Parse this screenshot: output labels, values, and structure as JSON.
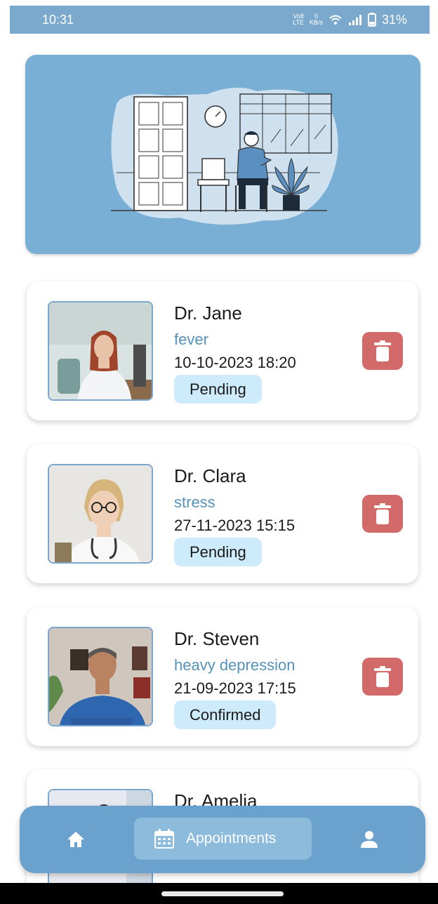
{
  "status_bar": {
    "time": "10:31",
    "net_label_top": "Vo8",
    "net_label_bottom": "LTE",
    "speed_value": "0",
    "speed_unit": "KB/s",
    "battery": "31%"
  },
  "appointments": [
    {
      "doctor": "Dr. Jane",
      "reason": "fever",
      "datetime": "10-10-2023  18:20",
      "status": "Pending"
    },
    {
      "doctor": "Dr. Clara",
      "reason": "stress",
      "datetime": "27-11-2023  15:15",
      "status": "Pending"
    },
    {
      "doctor": "Dr. Steven",
      "reason": "heavy depression",
      "datetime": "21-09-2023  17:15",
      "status": "Confirmed"
    },
    {
      "doctor": "Dr. Amelia"
    }
  ],
  "bottom_nav": {
    "active_label": "Appointments"
  },
  "colors": {
    "primary": "#7aafd5",
    "nav": "#6aa2cd",
    "delete": "#d26a6a",
    "status_bg": "#cdebfa",
    "reason_text": "#5592b9"
  }
}
